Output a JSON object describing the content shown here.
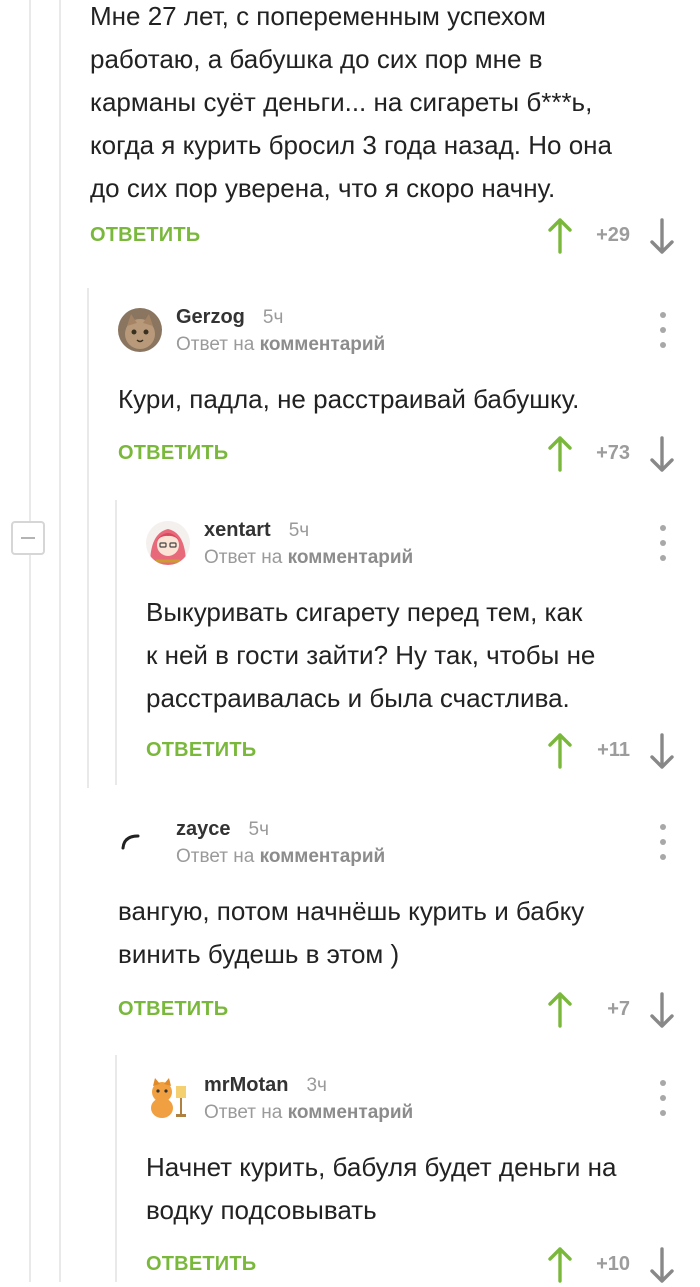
{
  "labels": {
    "reply_to_prefix": "Ответ на",
    "reply_to_target": "комментарий",
    "reply_button": "ОТВЕТИТЬ"
  },
  "colors": {
    "reply_green": "#7ab83c",
    "upvote_green": "#7ab83c",
    "muted": "#9a9a9a"
  },
  "icons": [
    "avatar",
    "kebab-menu-icon",
    "upvote-arrow-icon",
    "downvote-arrow-icon",
    "collapse-thread-icon"
  ],
  "comments": [
    {
      "author": "",
      "time": "",
      "lines": [
        "Мне 27 лет, с попеременным успехом",
        "работаю, а бабушка до сих пор мне в",
        "карманы суёт деньги... на сигареты б***ь,",
        "когда я курить бросил 3 года назад. Но она",
        "до сих пор уверена, что я скоро начну."
      ],
      "rating": "+29"
    },
    {
      "author": "Gerzog",
      "time": "5ч",
      "lines": [
        "Кури, падла, не расстраивай бабушку."
      ],
      "rating": "+73"
    },
    {
      "author": "xentart",
      "time": "5ч",
      "lines": [
        "Выкуривать сигарету перед тем, как",
        "к ней в гости зайти? Ну так, чтобы не",
        "расстраивалась и была счастлива."
      ],
      "rating": "+11"
    },
    {
      "author": "zayce",
      "time": "5ч",
      "lines": [
        "вангую, потом начнёшь курить и бабку",
        "винить будешь в этом )"
      ],
      "rating": "+7"
    },
    {
      "author": "mrMotan",
      "time": "3ч",
      "lines": [
        "Начнет курить, бабуля будет деньги на",
        "водку подсовывать"
      ],
      "rating": "+10"
    }
  ]
}
